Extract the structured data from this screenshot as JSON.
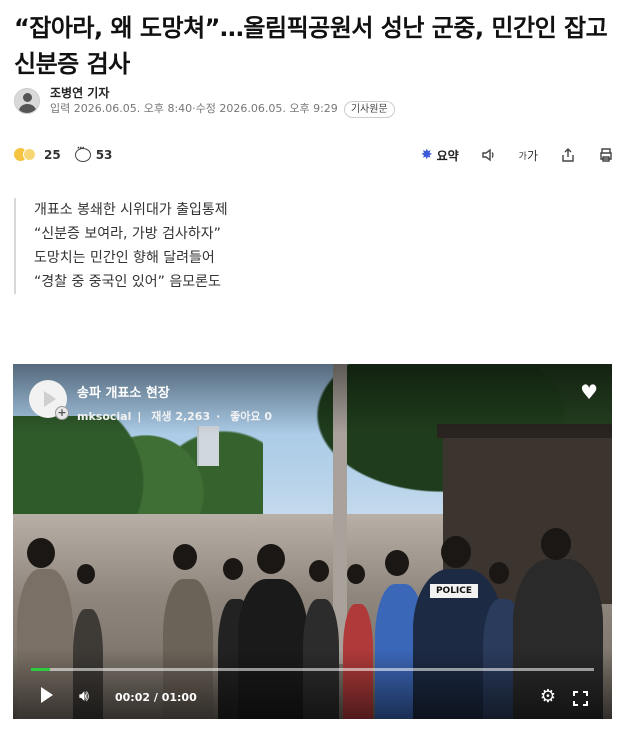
{
  "article": {
    "headline": "“잡아라, 왜 도망쳐”…올림픽공원서 성난 군중, 민간인 잡고 신분증 검사",
    "reporter": "조병연 기자",
    "published": "입력 2026.06.05. 오후 8:40",
    "modified": "수정 2026.06.05. 오후 9:29",
    "original_link_label": "기사원문"
  },
  "toolbar": {
    "reaction_count": "25",
    "comment_count": "53",
    "summary_label": "요약",
    "font_label": "가"
  },
  "subheads": [
    "개표소 봉쇄한 시위대가 출입통제",
    "“신분증 보여라, 가방 검사하자”",
    "도망치는 민간인 향해 달려들어",
    "“경찰 중 중국인 있어” 음모론도"
  ],
  "video": {
    "title": "송파 개표소 현장",
    "channel": "mksocial",
    "views": "재생 2,263",
    "likes": "좋아요 0",
    "current_time": "00:02",
    "duration": "01:00",
    "progress_fraction": 0.033,
    "progress_color": "#2ecc40",
    "vest_label": "POLICE"
  },
  "icons": {
    "reaction": "emoji-reaction-icon",
    "comment": "comment-bubble-icon",
    "summary": "sparkle-summary-icon",
    "tts": "speaker-icon",
    "font": "font-size-icon",
    "share": "share-icon",
    "print": "print-icon",
    "heart": "heart-icon",
    "play": "play-icon",
    "volume": "volume-icon",
    "settings": "gear-icon",
    "fullscreen": "fullscreen-icon"
  },
  "colors": {
    "summary_accent": "#3b5bdb",
    "headline": "#111111"
  }
}
